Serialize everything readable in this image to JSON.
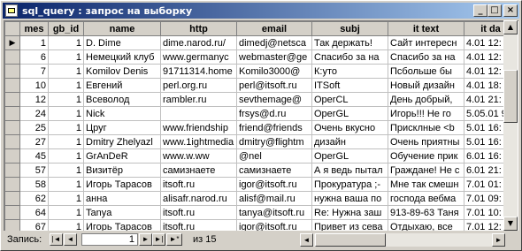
{
  "window": {
    "title": "sql_query : запрос на выборку"
  },
  "title_buttons": {
    "minimize": "_",
    "maximize": "□",
    "close": "×"
  },
  "columns": [
    "mes",
    "gb_id",
    "name",
    "http",
    "email",
    "subj",
    "it text",
    "it da"
  ],
  "rows": [
    {
      "mes": "1",
      "gb_id": "1",
      "name": "D. Dime",
      "http": "dime.narod.ru/",
      "email": "dimedj@netsca",
      "subj": "Так держать!",
      "it_text": "Сайт интересн",
      "it_da": "4.01 12:"
    },
    {
      "mes": "6",
      "gb_id": "1",
      "name": "Немецкий клуб",
      "http": "www.germanyc",
      "email": "webmaster@ge",
      "subj": "Спасибо за на",
      "it_text": "Спасибо за на",
      "it_da": "4.01 12:"
    },
    {
      "mes": "7",
      "gb_id": "1",
      "name": "Komilov Denis",
      "http": "91711314.home",
      "email": "Komilo3000@",
      "subj": "К:уто",
      "it_text": "Псбольше бы",
      "it_da": "4.01 12:"
    },
    {
      "mes": "10",
      "gb_id": "1",
      "name": "Евгений",
      "http": "perl.org.ru",
      "email": "perl@itsoft.ru",
      "subj": "ITSoft",
      "it_text": "Новый дизайн",
      "it_da": "4.01 18:"
    },
    {
      "mes": "12",
      "gb_id": "1",
      "name": "Всеволод",
      "http": "rambler.ru",
      "email": "sevthemage@",
      "subj": "OperCL",
      "it_text": "День добрый,",
      "it_da": "4.01 21:"
    },
    {
      "mes": "24",
      "gb_id": "1",
      "name": "Nick",
      "http": "",
      "email": "frsys@d.ru",
      "subj": "OperGL",
      "it_text": "Игорь!!! Не го",
      "it_da": "5.05.01 9"
    },
    {
      "mes": "25",
      "gb_id": "1",
      "name": "Цруг",
      "http": "www.friendship",
      "email": "friend@friends",
      "subj": "Очень вкусно",
      "it_text": "Присклные <b",
      "it_da": "5.01 16:"
    },
    {
      "mes": "27",
      "gb_id": "1",
      "name": "Dmitry Zhelyazl",
      "http": "www.1ightmedia",
      "email": "dmitry@flightm",
      "subj": "дизайн",
      "it_text": "Очень приятны",
      "it_da": "5.01 16:"
    },
    {
      "mes": "45",
      "gb_id": "1",
      "name": "GrAnDeR",
      "http": "www.w.ww",
      "email": "@nel",
      "subj": "OperGL",
      "it_text": "Обучение прик",
      "it_da": "6.01 16:"
    },
    {
      "mes": "57",
      "gb_id": "1",
      "name": "Визитёр",
      "http": "самизнаете",
      "email": "самизнаете",
      "subj": "А я ведь пытал",
      "it_text": "Граждане! Не с",
      "it_da": "6.01 21:"
    },
    {
      "mes": "58",
      "gb_id": "1",
      "name": "Игорь Тарасов",
      "http": "itsoft.ru",
      "email": "igor@itsoft.ru",
      "subj": "Прокуратура ;-",
      "it_text": "Мне так смешн",
      "it_da": "7.01 01:"
    },
    {
      "mes": "62",
      "gb_id": "1",
      "name": "анна",
      "http": "alisafr.narod.ru",
      "email": "alisf@mail.ru",
      "subj": "нужна ваша по",
      "it_text": "господа вебма",
      "it_da": "7.01 09:"
    },
    {
      "mes": "64",
      "gb_id": "1",
      "name": "Tanya",
      "http": "itsoft.ru",
      "email": "tanya@itsoft.ru",
      "subj": "Re: Нужна заш",
      "it_text": "913-89-63 Таня",
      "it_da": "7.01 10:"
    },
    {
      "mes": "67",
      "gb_id": "1",
      "name": "Игорь Тарасов",
      "http": "itsoft.ru",
      "email": "igor@itsoft.ru",
      "subj": "Привет из сева",
      "it_text": "Отдыхаю, все",
      "it_da": "7.01 12:"
    }
  ],
  "navigation": {
    "label": "Запись:",
    "current": "1",
    "of_text": "из 15",
    "first": "|◄",
    "prev": "◄",
    "next": "►",
    "last": "►|",
    "new": "►*"
  },
  "scroll": {
    "up": "▲",
    "down": "▼",
    "left": "◄",
    "right": "►"
  }
}
